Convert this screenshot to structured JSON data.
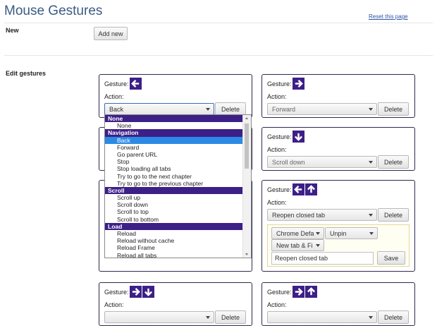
{
  "page": {
    "title": "Mouse Gestures",
    "reset_link": "Reset this page"
  },
  "new_section": {
    "label": "New",
    "add_button": "Add new"
  },
  "edit_section": {
    "label": "Edit gestures"
  },
  "common": {
    "gesture_label": "Gesture:",
    "action_label": "Action:",
    "delete_label": "Delete",
    "save_label": "Save"
  },
  "gestures": [
    {
      "icons": [
        "arrow-left-icon"
      ],
      "action": "Back",
      "dropdown_open": true
    },
    {
      "icons": [
        "arrow-right-icon"
      ],
      "action": "Forward"
    },
    {
      "icons": [
        "arrow-down-icon"
      ],
      "action": "Scroll down"
    },
    {
      "icons": [
        "arrow-left-icon",
        "arrow-up-icon"
      ],
      "action": "Reopen closed tab",
      "options": {
        "open_in": "Chrome Defa",
        "pin": "Unpin",
        "tab_mode": "New tab & Fi",
        "text_value": "Reopen closed tab"
      }
    },
    {
      "icons": [
        "arrow-right-icon",
        "arrow-down-icon"
      ]
    },
    {
      "icons": [
        "arrow-right-icon",
        "arrow-up-icon"
      ]
    }
  ],
  "dropdown": {
    "groups": [
      {
        "label": "None",
        "options": [
          "None"
        ]
      },
      {
        "label": "Navigation",
        "options": [
          "Back",
          "Forward",
          "Go parent URL",
          "Stop",
          "Stop loading all tabs",
          "Try to go to the next chapter",
          "Try to go to the previous chapter"
        ]
      },
      {
        "label": "Scroll",
        "options": [
          "Scroll up",
          "Scroll down",
          "Scroll to top",
          "Scroll to bottom"
        ]
      },
      {
        "label": "Load",
        "options": [
          "Reload",
          "Reload without cache",
          "Reload Frame",
          "Reload all tabs"
        ]
      }
    ],
    "selected": "Back"
  },
  "colors": {
    "accent": "#3d1f88",
    "selected": "#2b8ae3",
    "title": "#3a5a84"
  }
}
